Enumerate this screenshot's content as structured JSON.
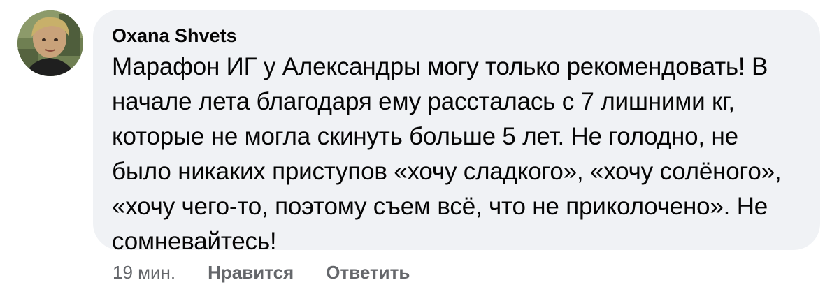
{
  "comment": {
    "author": "Oxana Shvets",
    "text": "Марафон ИГ у Александры могу только рекомендовать! В начале лета благодаря ему рассталась с 7 лишними кг, которые не могла скинуть больше 5 лет. Не голодно, не было никаких приступов «хочу сладкого», «хочу солёного», «хочу чего-то, поэтому съем всё, что не приколочено». Не сомневайтесь!",
    "avatar": "profile-photo"
  },
  "actions": {
    "time": "19 мин.",
    "like_label": "Нравится",
    "reply_label": "Ответить"
  },
  "colors": {
    "bubble_bg": "#f0f2f5",
    "text": "#050505",
    "secondary_text": "#65676b"
  }
}
